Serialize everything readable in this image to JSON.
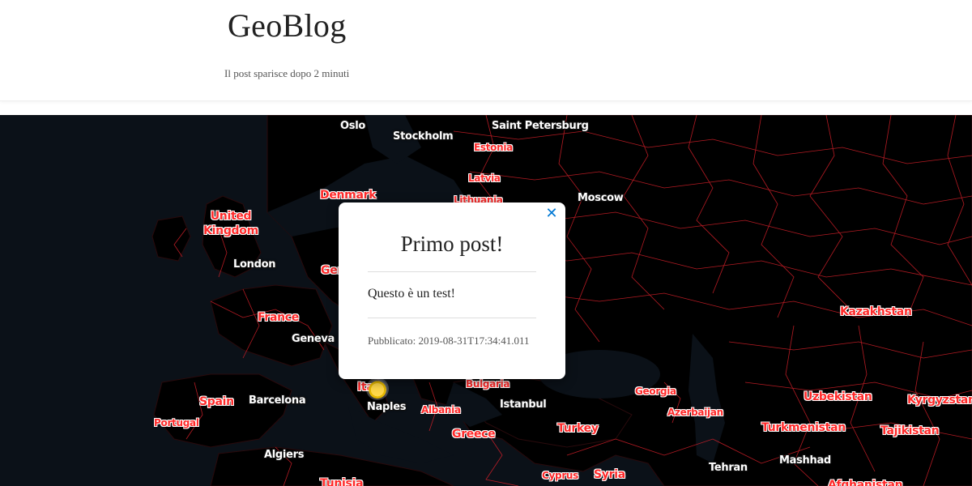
{
  "header": {
    "site_title": "GeoBlog",
    "tagline": "Il post sparisce dopo 2 minuti"
  },
  "map": {
    "city_labels": [
      "Oslo",
      "Stockholm",
      "Saint Petersburg",
      "Moscow",
      "London",
      "Geneva",
      "Barcelona",
      "Naples",
      "Istanbul",
      "Algiers",
      "Tehran",
      "Mashhad"
    ],
    "country_labels": [
      "Estonia",
      "Latvia",
      "Lithuania",
      "Denmark",
      "United Kingdom",
      "France",
      "Germany",
      "Italy",
      "Spain",
      "Portugal",
      "Albania",
      "Bulgaria",
      "Greece",
      "Turkey",
      "Georgia",
      "Azerbaijan",
      "Kazakhstan",
      "Uzbekistan",
      "Kyrgyzstan",
      "Turkmenistan",
      "Tajikistan",
      "Syria",
      "Cyprus",
      "Tunisia",
      "Afghanistan"
    ],
    "colors": {
      "water": "#0b1118",
      "land": "#000000",
      "borders": "#d4202a"
    }
  },
  "popup": {
    "close_icon": "close-icon",
    "title": "Primo post!",
    "body": "Questo è un test!",
    "published": "Pubblicato: 2019-08-31T17:34:41.011"
  }
}
